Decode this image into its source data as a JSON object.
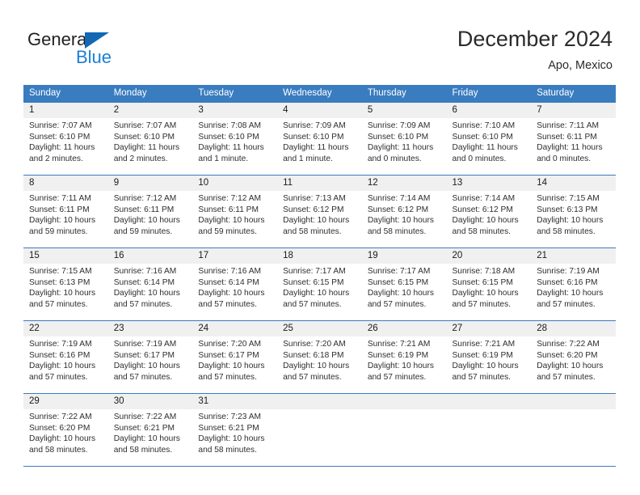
{
  "brand": {
    "word1": "General",
    "word2": "Blue",
    "triangle_color": "#1268b3",
    "blue_text_color": "#1b7fd4"
  },
  "header": {
    "title": "December 2024",
    "subtitle": "Apo, Mexico"
  },
  "theme": {
    "header_blue": "#3a7cc0",
    "daynum_band": "#f0f0f0",
    "text": "#2e2e2e"
  },
  "weekday_headers": [
    "Sunday",
    "Monday",
    "Tuesday",
    "Wednesday",
    "Thursday",
    "Friday",
    "Saturday"
  ],
  "labels": {
    "sunrise": "Sunrise:",
    "sunset": "Sunset:",
    "daylight": "Daylight:"
  },
  "weeks": [
    [
      {
        "day": "1",
        "sunrise": "Sunrise: 7:07 AM",
        "sunset": "Sunset: 6:10 PM",
        "daylight_line1": "Daylight: 11 hours",
        "daylight_line2": "and 2 minutes."
      },
      {
        "day": "2",
        "sunrise": "Sunrise: 7:07 AM",
        "sunset": "Sunset: 6:10 PM",
        "daylight_line1": "Daylight: 11 hours",
        "daylight_line2": "and 2 minutes."
      },
      {
        "day": "3",
        "sunrise": "Sunrise: 7:08 AM",
        "sunset": "Sunset: 6:10 PM",
        "daylight_line1": "Daylight: 11 hours",
        "daylight_line2": "and 1 minute."
      },
      {
        "day": "4",
        "sunrise": "Sunrise: 7:09 AM",
        "sunset": "Sunset: 6:10 PM",
        "daylight_line1": "Daylight: 11 hours",
        "daylight_line2": "and 1 minute."
      },
      {
        "day": "5",
        "sunrise": "Sunrise: 7:09 AM",
        "sunset": "Sunset: 6:10 PM",
        "daylight_line1": "Daylight: 11 hours",
        "daylight_line2": "and 0 minutes."
      },
      {
        "day": "6",
        "sunrise": "Sunrise: 7:10 AM",
        "sunset": "Sunset: 6:10 PM",
        "daylight_line1": "Daylight: 11 hours",
        "daylight_line2": "and 0 minutes."
      },
      {
        "day": "7",
        "sunrise": "Sunrise: 7:11 AM",
        "sunset": "Sunset: 6:11 PM",
        "daylight_line1": "Daylight: 11 hours",
        "daylight_line2": "and 0 minutes."
      }
    ],
    [
      {
        "day": "8",
        "sunrise": "Sunrise: 7:11 AM",
        "sunset": "Sunset: 6:11 PM",
        "daylight_line1": "Daylight: 10 hours",
        "daylight_line2": "and 59 minutes."
      },
      {
        "day": "9",
        "sunrise": "Sunrise: 7:12 AM",
        "sunset": "Sunset: 6:11 PM",
        "daylight_line1": "Daylight: 10 hours",
        "daylight_line2": "and 59 minutes."
      },
      {
        "day": "10",
        "sunrise": "Sunrise: 7:12 AM",
        "sunset": "Sunset: 6:11 PM",
        "daylight_line1": "Daylight: 10 hours",
        "daylight_line2": "and 59 minutes."
      },
      {
        "day": "11",
        "sunrise": "Sunrise: 7:13 AM",
        "sunset": "Sunset: 6:12 PM",
        "daylight_line1": "Daylight: 10 hours",
        "daylight_line2": "and 58 minutes."
      },
      {
        "day": "12",
        "sunrise": "Sunrise: 7:14 AM",
        "sunset": "Sunset: 6:12 PM",
        "daylight_line1": "Daylight: 10 hours",
        "daylight_line2": "and 58 minutes."
      },
      {
        "day": "13",
        "sunrise": "Sunrise: 7:14 AM",
        "sunset": "Sunset: 6:12 PM",
        "daylight_line1": "Daylight: 10 hours",
        "daylight_line2": "and 58 minutes."
      },
      {
        "day": "14",
        "sunrise": "Sunrise: 7:15 AM",
        "sunset": "Sunset: 6:13 PM",
        "daylight_line1": "Daylight: 10 hours",
        "daylight_line2": "and 58 minutes."
      }
    ],
    [
      {
        "day": "15",
        "sunrise": "Sunrise: 7:15 AM",
        "sunset": "Sunset: 6:13 PM",
        "daylight_line1": "Daylight: 10 hours",
        "daylight_line2": "and 57 minutes."
      },
      {
        "day": "16",
        "sunrise": "Sunrise: 7:16 AM",
        "sunset": "Sunset: 6:14 PM",
        "daylight_line1": "Daylight: 10 hours",
        "daylight_line2": "and 57 minutes."
      },
      {
        "day": "17",
        "sunrise": "Sunrise: 7:16 AM",
        "sunset": "Sunset: 6:14 PM",
        "daylight_line1": "Daylight: 10 hours",
        "daylight_line2": "and 57 minutes."
      },
      {
        "day": "18",
        "sunrise": "Sunrise: 7:17 AM",
        "sunset": "Sunset: 6:15 PM",
        "daylight_line1": "Daylight: 10 hours",
        "daylight_line2": "and 57 minutes."
      },
      {
        "day": "19",
        "sunrise": "Sunrise: 7:17 AM",
        "sunset": "Sunset: 6:15 PM",
        "daylight_line1": "Daylight: 10 hours",
        "daylight_line2": "and 57 minutes."
      },
      {
        "day": "20",
        "sunrise": "Sunrise: 7:18 AM",
        "sunset": "Sunset: 6:15 PM",
        "daylight_line1": "Daylight: 10 hours",
        "daylight_line2": "and 57 minutes."
      },
      {
        "day": "21",
        "sunrise": "Sunrise: 7:19 AM",
        "sunset": "Sunset: 6:16 PM",
        "daylight_line1": "Daylight: 10 hours",
        "daylight_line2": "and 57 minutes."
      }
    ],
    [
      {
        "day": "22",
        "sunrise": "Sunrise: 7:19 AM",
        "sunset": "Sunset: 6:16 PM",
        "daylight_line1": "Daylight: 10 hours",
        "daylight_line2": "and 57 minutes."
      },
      {
        "day": "23",
        "sunrise": "Sunrise: 7:19 AM",
        "sunset": "Sunset: 6:17 PM",
        "daylight_line1": "Daylight: 10 hours",
        "daylight_line2": "and 57 minutes."
      },
      {
        "day": "24",
        "sunrise": "Sunrise: 7:20 AM",
        "sunset": "Sunset: 6:17 PM",
        "daylight_line1": "Daylight: 10 hours",
        "daylight_line2": "and 57 minutes."
      },
      {
        "day": "25",
        "sunrise": "Sunrise: 7:20 AM",
        "sunset": "Sunset: 6:18 PM",
        "daylight_line1": "Daylight: 10 hours",
        "daylight_line2": "and 57 minutes."
      },
      {
        "day": "26",
        "sunrise": "Sunrise: 7:21 AM",
        "sunset": "Sunset: 6:19 PM",
        "daylight_line1": "Daylight: 10 hours",
        "daylight_line2": "and 57 minutes."
      },
      {
        "day": "27",
        "sunrise": "Sunrise: 7:21 AM",
        "sunset": "Sunset: 6:19 PM",
        "daylight_line1": "Daylight: 10 hours",
        "daylight_line2": "and 57 minutes."
      },
      {
        "day": "28",
        "sunrise": "Sunrise: 7:22 AM",
        "sunset": "Sunset: 6:20 PM",
        "daylight_line1": "Daylight: 10 hours",
        "daylight_line2": "and 57 minutes."
      }
    ],
    [
      {
        "day": "29",
        "sunrise": "Sunrise: 7:22 AM",
        "sunset": "Sunset: 6:20 PM",
        "daylight_line1": "Daylight: 10 hours",
        "daylight_line2": "and 58 minutes."
      },
      {
        "day": "30",
        "sunrise": "Sunrise: 7:22 AM",
        "sunset": "Sunset: 6:21 PM",
        "daylight_line1": "Daylight: 10 hours",
        "daylight_line2": "and 58 minutes."
      },
      {
        "day": "31",
        "sunrise": "Sunrise: 7:23 AM",
        "sunset": "Sunset: 6:21 PM",
        "daylight_line1": "Daylight: 10 hours",
        "daylight_line2": "and 58 minutes."
      },
      {
        "day": "",
        "sunrise": "",
        "sunset": "",
        "daylight_line1": "",
        "daylight_line2": ""
      },
      {
        "day": "",
        "sunrise": "",
        "sunset": "",
        "daylight_line1": "",
        "daylight_line2": ""
      },
      {
        "day": "",
        "sunrise": "",
        "sunset": "",
        "daylight_line1": "",
        "daylight_line2": ""
      },
      {
        "day": "",
        "sunrise": "",
        "sunset": "",
        "daylight_line1": "",
        "daylight_line2": ""
      }
    ]
  ]
}
